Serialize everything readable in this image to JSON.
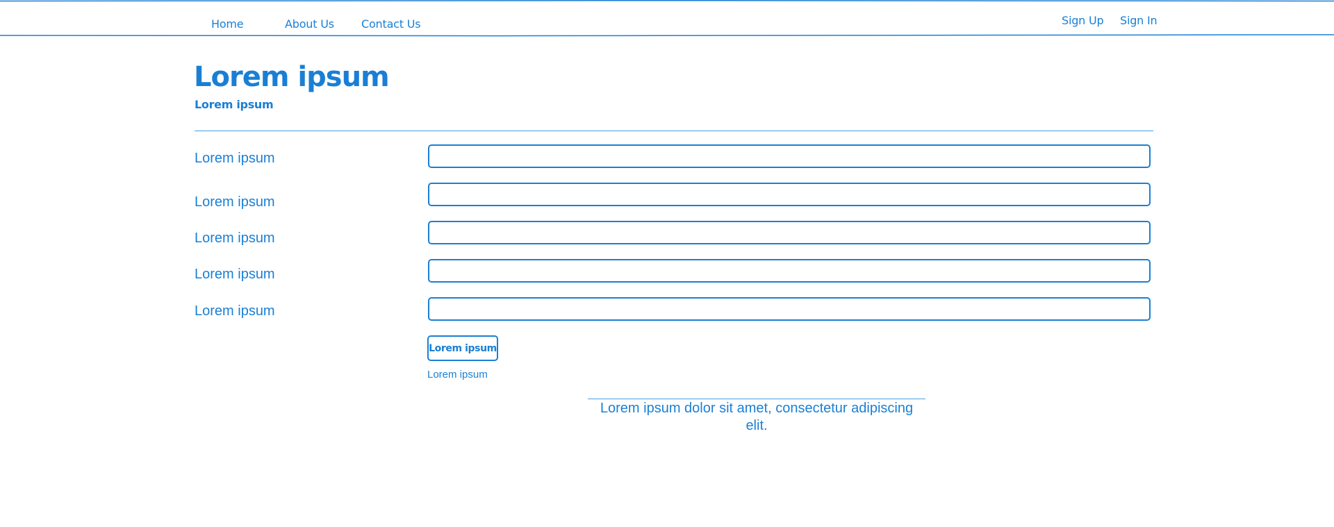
{
  "colors": {
    "accent": "#1a7fd4",
    "background": "#ffffff"
  },
  "nav": {
    "left_links": [
      "Home",
      "About Us",
      "Contact Us"
    ],
    "right_links": [
      "Sign Up",
      "Sign In"
    ]
  },
  "header": {
    "title": "Lorem ipsum",
    "subtitle": "Lorem ipsum"
  },
  "form": {
    "fields": [
      {
        "label": "Lorem ipsum",
        "value": ""
      },
      {
        "label": "Lorem ipsum",
        "value": ""
      },
      {
        "label": "Lorem ipsum",
        "value": ""
      },
      {
        "label": "Lorem ipsum",
        "value": ""
      },
      {
        "label": "Lorem ipsum",
        "value": ""
      }
    ],
    "submit_label": "Lorem ipsum",
    "helper_link": "Lorem ipsum"
  },
  "footer": {
    "text": "Lorem ipsum dolor sit amet, consectetur adipiscing elit."
  }
}
